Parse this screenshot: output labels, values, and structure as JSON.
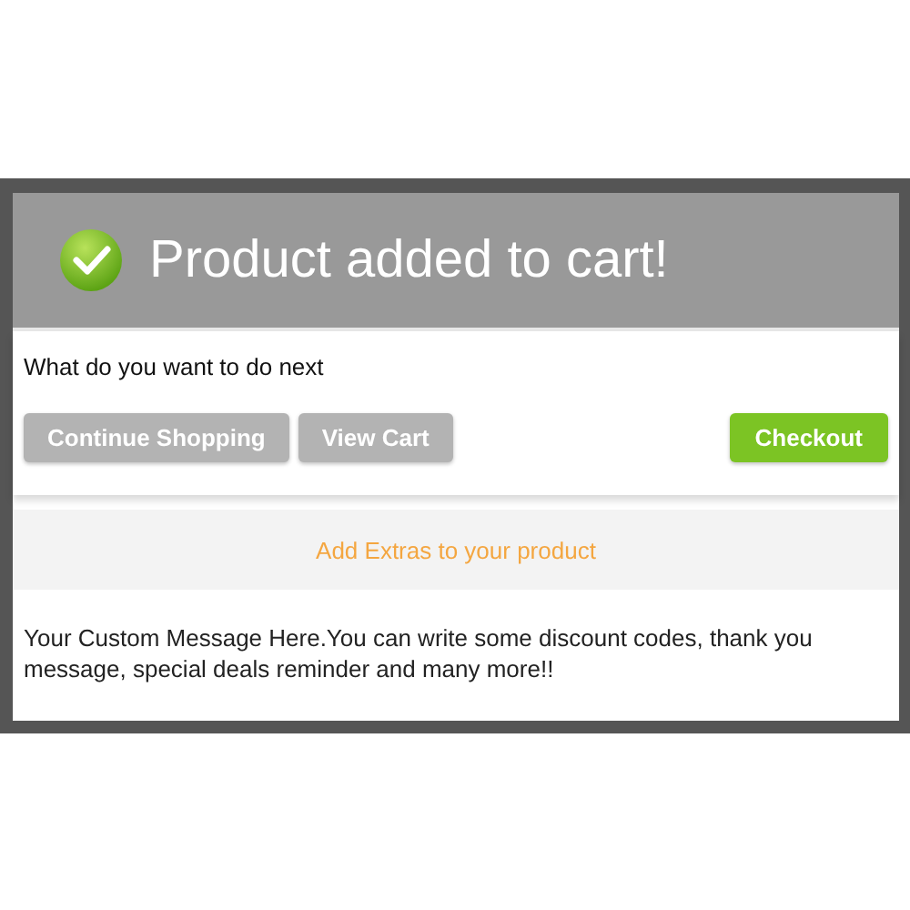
{
  "dialog": {
    "title": "Product added to cart!",
    "prompt": "What do you want to do next",
    "buttons": [
      {
        "label": "Continue Shopping",
        "kind": "secondary"
      },
      {
        "label": "View Cart",
        "kind": "secondary"
      },
      {
        "label": "Checkout",
        "kind": "primary"
      }
    ],
    "extras_link": "Add Extras to your product",
    "message": "Your Custom Message Here.You can write some discount codes, thank you message, special deals reminder and many more!!"
  }
}
